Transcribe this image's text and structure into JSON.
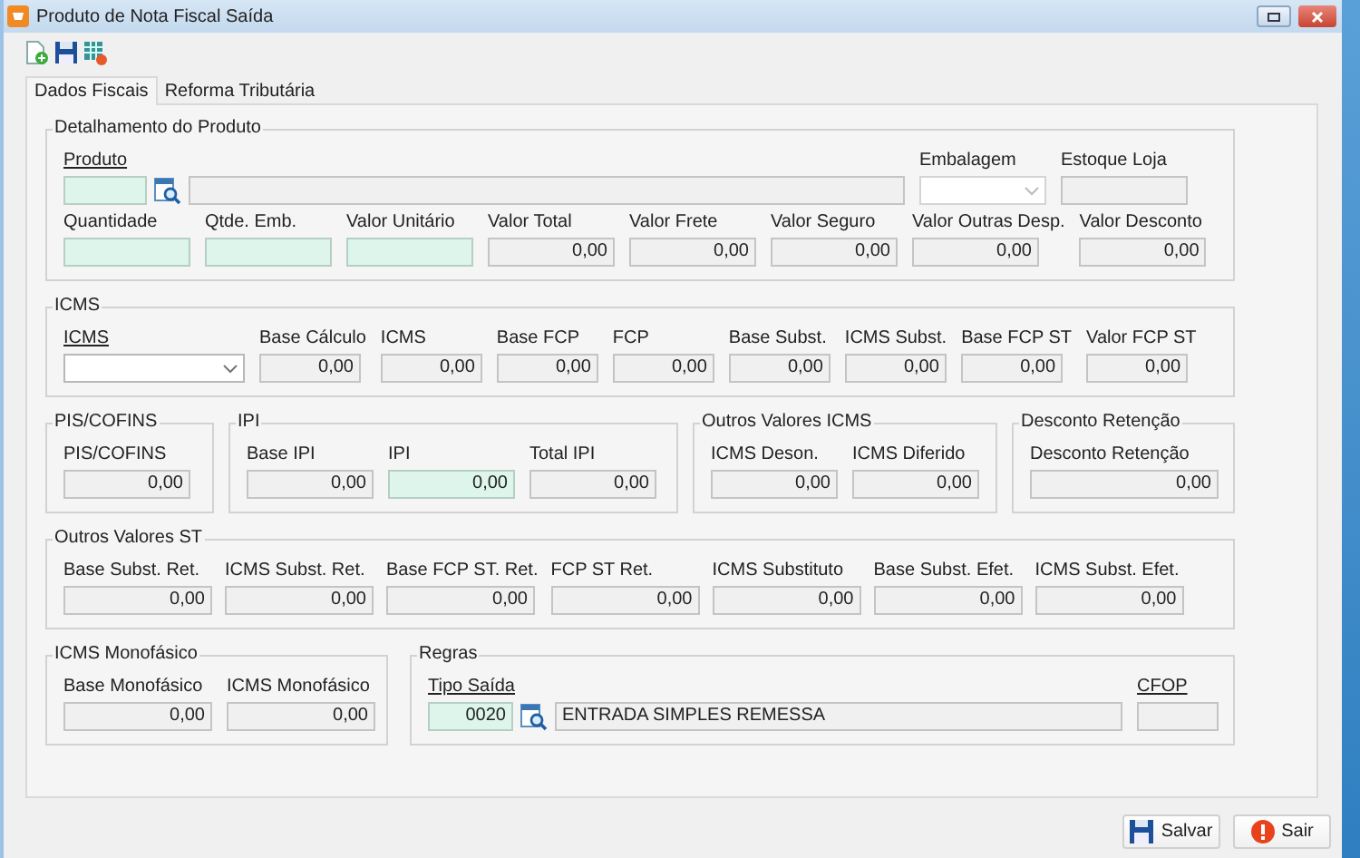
{
  "window": {
    "title": "Produto de Nota Fiscal Saída"
  },
  "tabs": [
    {
      "label": "Dados Fiscais",
      "selected": true
    },
    {
      "label": "Reforma Tributária",
      "selected": false
    }
  ],
  "groups": [
    {
      "title": "Detalhamento do Produto",
      "fields": [
        {
          "label": "Produto",
          "link": true,
          "kind": "lookup"
        },
        {
          "label": "Embalagem",
          "link": false,
          "kind": "combo",
          "disabled": true
        },
        {
          "label": "Estoque Loja",
          "link": false,
          "kind": "readonly"
        },
        {
          "label": "Quantidade",
          "link": false,
          "kind": "editable"
        },
        {
          "label": "Qtde. Emb.",
          "link": false,
          "kind": "editable"
        },
        {
          "label": "Valor Unitário",
          "link": false,
          "kind": "editable"
        },
        {
          "label": "Valor Total",
          "link": false,
          "kind": "readonly",
          "value": "0,00"
        },
        {
          "label": "Valor Frete",
          "link": false,
          "kind": "readonly",
          "value": "0,00"
        },
        {
          "label": "Valor Seguro",
          "link": false,
          "kind": "readonly",
          "value": "0,00"
        },
        {
          "label": "Valor Outras Desp.",
          "link": false,
          "kind": "readonly",
          "value": "0,00"
        },
        {
          "label": "Valor Desconto",
          "link": false,
          "kind": "readonly",
          "value": "0,00"
        }
      ]
    },
    {
      "title": "ICMS",
      "fields": [
        {
          "label": "ICMS",
          "link": true,
          "kind": "combo",
          "disabled": false
        },
        {
          "label": "Base Cálculo",
          "link": false,
          "kind": "readonly",
          "value": "0,00"
        },
        {
          "label": "ICMS",
          "link": false,
          "kind": "readonly",
          "value": "0,00"
        },
        {
          "label": "Base FCP",
          "link": false,
          "kind": "readonly",
          "value": "0,00"
        },
        {
          "label": "FCP",
          "link": false,
          "kind": "readonly",
          "value": "0,00"
        },
        {
          "label": "Base Subst.",
          "link": false,
          "kind": "readonly",
          "value": "0,00"
        },
        {
          "label": "ICMS Subst.",
          "link": false,
          "kind": "readonly",
          "value": "0,00"
        },
        {
          "label": "Base FCP ST",
          "link": false,
          "kind": "readonly",
          "value": "0,00"
        },
        {
          "label": "Valor FCP ST",
          "link": false,
          "kind": "readonly",
          "value": "0,00"
        }
      ]
    },
    {
      "title": "PIS/COFINS",
      "fields": [
        {
          "label": "PIS/COFINS",
          "link": false,
          "kind": "readonly",
          "value": "0,00"
        }
      ]
    },
    {
      "title": "IPI",
      "fields": [
        {
          "label": "Base IPI",
          "link": false,
          "kind": "readonly",
          "value": "0,00"
        },
        {
          "label": "IPI",
          "link": false,
          "kind": "editable",
          "value": "0,00"
        },
        {
          "label": "Total IPI",
          "link": false,
          "kind": "readonly",
          "value": "0,00"
        }
      ]
    },
    {
      "title": "Outros Valores ICMS",
      "fields": [
        {
          "label": "ICMS Deson.",
          "link": false,
          "kind": "readonly",
          "value": "0,00"
        },
        {
          "label": "ICMS Diferido",
          "link": false,
          "kind": "readonly",
          "value": "0,00"
        }
      ]
    },
    {
      "title": "Desconto Retenção",
      "fields": [
        {
          "label": "Desconto Retenção",
          "link": false,
          "kind": "readonly",
          "value": "0,00"
        }
      ]
    },
    {
      "title": "Outros Valores ST",
      "fields": [
        {
          "label": "Base Subst. Ret.",
          "link": false,
          "kind": "readonly",
          "value": "0,00"
        },
        {
          "label": "ICMS Subst. Ret.",
          "link": false,
          "kind": "readonly",
          "value": "0,00"
        },
        {
          "label": "Base FCP ST. Ret.",
          "link": false,
          "kind": "readonly",
          "value": "0,00"
        },
        {
          "label": "FCP ST Ret.",
          "link": false,
          "kind": "readonly",
          "value": "0,00"
        },
        {
          "label": "ICMS Substituto",
          "link": false,
          "kind": "readonly",
          "value": "0,00"
        },
        {
          "label": "Base Subst. Efet.",
          "link": false,
          "kind": "readonly",
          "value": "0,00"
        },
        {
          "label": "ICMS Subst. Efet.",
          "link": false,
          "kind": "readonly",
          "value": "0,00"
        }
      ]
    },
    {
      "title": "ICMS Monofásico",
      "fields": [
        {
          "label": "Base Monofásico",
          "link": false,
          "kind": "readonly",
          "value": "0,00"
        },
        {
          "label": "ICMS Monofásico",
          "link": false,
          "kind": "readonly",
          "value": "0,00"
        }
      ]
    },
    {
      "title": "Regras",
      "fields": [
        {
          "label": "Tipo Saída",
          "link": true,
          "kind": "lookup",
          "code": "0020",
          "description": "ENTRADA SIMPLES REMESSA"
        },
        {
          "label": "CFOP",
          "link": true,
          "kind": "readonly"
        }
      ]
    }
  ],
  "buttons": [
    {
      "label": "Salvar",
      "kind": "save"
    },
    {
      "label": "Sair",
      "kind": "exit"
    }
  ]
}
